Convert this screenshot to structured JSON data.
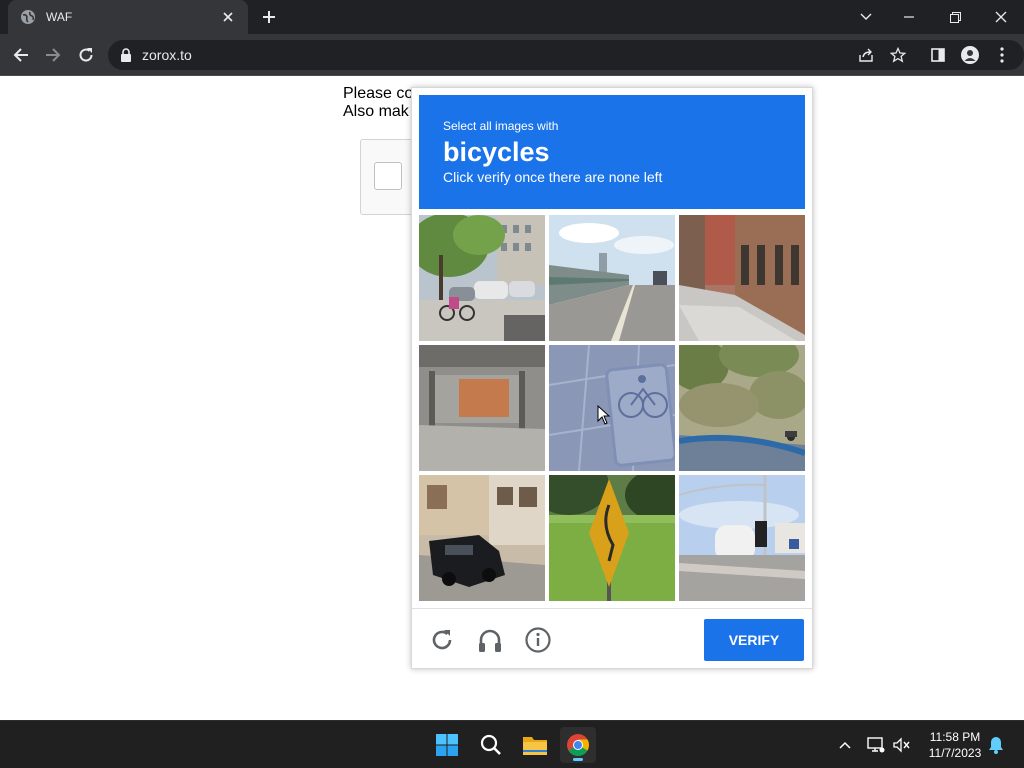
{
  "browser": {
    "tab_title": "WAF",
    "url": "zorox.to"
  },
  "page": {
    "line1": "Please co",
    "line2": "Also mak"
  },
  "challenge": {
    "prompt_small": "Select all images with",
    "prompt_object": "bicycles",
    "prompt_note": "Click verify once there are none left",
    "verify_label": "VERIFY",
    "accent_color": "#1a73e8",
    "tiles": [
      {
        "scene": "street with parked cars and bicycles"
      },
      {
        "scene": "highway with wall"
      },
      {
        "scene": "sidewalk with brick houses"
      },
      {
        "scene": "parking garage"
      },
      {
        "scene": "bicycle lane marking"
      },
      {
        "scene": "hillside with trees and motorbike"
      },
      {
        "scene": "parked black car"
      },
      {
        "scene": "yellow road sign in park"
      },
      {
        "scene": "intersection with traffic light"
      }
    ]
  },
  "taskbar": {
    "time": "11:58 PM",
    "date": "11/7/2023"
  }
}
